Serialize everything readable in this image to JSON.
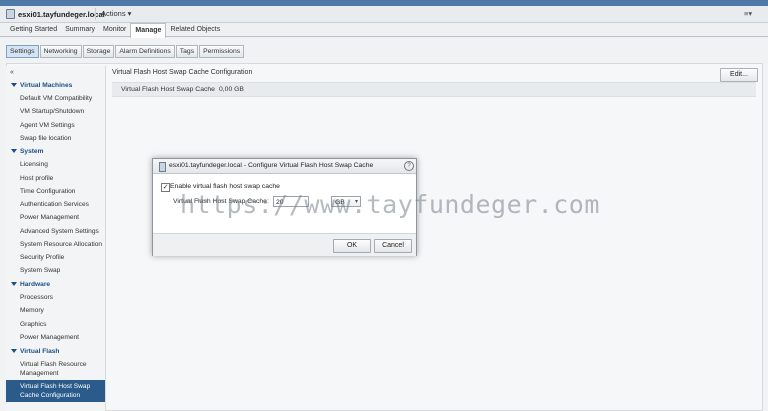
{
  "header": {
    "host_name": "esxi01.tayfundeger.local",
    "actions_label": "Actions ▾",
    "collapse_label": "≡▾"
  },
  "main_tabs": [
    "Getting Started",
    "Summary",
    "Monitor",
    "Manage",
    "Related Objects"
  ],
  "active_main_tab": "Manage",
  "sub_tabs": [
    "Settings",
    "Networking",
    "Storage",
    "Alarm Definitions",
    "Tags",
    "Permissions"
  ],
  "active_sub_tab": "Settings",
  "sidebar": {
    "collapse_icon": "«",
    "items": [
      {
        "label": "Virtual Machines",
        "group": true
      },
      {
        "label": "Default VM Compatibility"
      },
      {
        "label": "VM Startup/Shutdown"
      },
      {
        "label": "Agent VM Settings"
      },
      {
        "label": "Swap file location"
      },
      {
        "label": "System",
        "group": true
      },
      {
        "label": "Licensing"
      },
      {
        "label": "Host profile"
      },
      {
        "label": "Time Configuration"
      },
      {
        "label": "Authentication Services"
      },
      {
        "label": "Power Management"
      },
      {
        "label": "Advanced System Settings"
      },
      {
        "label": "System Resource Allocation"
      },
      {
        "label": "Security Profile"
      },
      {
        "label": "System Swap"
      },
      {
        "label": "Hardware",
        "group": true
      },
      {
        "label": "Processors"
      },
      {
        "label": "Memory"
      },
      {
        "label": "Graphics"
      },
      {
        "label": "Power Management"
      },
      {
        "label": "Virtual Flash",
        "group": true
      },
      {
        "label": "Virtual Flash Resource Management"
      },
      {
        "label": "Virtual Flash Host Swap Cache Configuration",
        "selected": true
      }
    ]
  },
  "panel": {
    "title": "Virtual Flash Host Swap Cache Configuration",
    "edit_label": "Edit...",
    "property_label": "Virtual Flash Host Swap Cache",
    "property_value": "0,00 GB"
  },
  "dialog": {
    "title": "esxi01.tayfundeger.local - Configure Virtual Flash Host Swap Cache",
    "help_icon": "?",
    "checkbox_label": "Enable virtual flash host swap cache",
    "checkbox_checked": "✓",
    "field_label": "Virtual Flash Host Swap Cache:",
    "field_value": "20",
    "unit_value": "GB",
    "unit_arrow": "▾",
    "ok_label": "OK",
    "cancel_label": "Cancel"
  },
  "watermark": "https://www.tayfundeger.com"
}
